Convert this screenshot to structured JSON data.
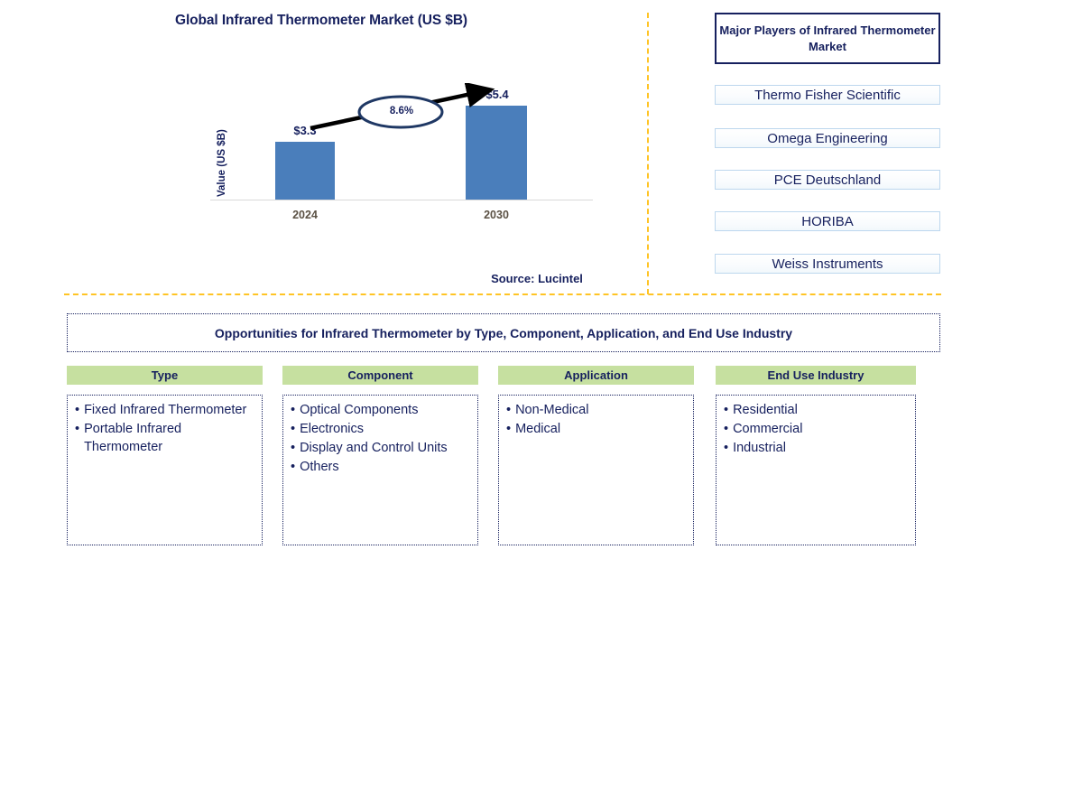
{
  "chart": {
    "title": "Global Infrared Thermometer Market (US $B)",
    "y_axis_label": "Value (US $B)",
    "source": "Source: Lucintel",
    "cagr_label": "8.6%"
  },
  "chart_data": {
    "type": "bar",
    "title": "Global Infrared Thermometer Market (US $B)",
    "xlabel": "",
    "ylabel": "Value (US $B)",
    "categories": [
      "2024",
      "2030"
    ],
    "values": [
      3.3,
      5.4
    ],
    "value_labels": [
      "$3.3",
      "$5.4"
    ],
    "cagr": "8.6%",
    "ylim": [
      0,
      5.4
    ],
    "grid": false,
    "legend": null,
    "bar_color": "#4A7EBB",
    "annotations": [
      "8.6%"
    ],
    "source": "Source: Lucintel"
  },
  "players": {
    "header": "Major Players of Infrared Thermometer Market",
    "items": [
      "Thermo Fisher Scientific",
      "Omega Engineering",
      "PCE Deutschland",
      "HORIBA",
      "Weiss Instruments"
    ]
  },
  "opportunities": {
    "banner": "Opportunities for Infrared Thermometer by Type, Component, Application, and End Use Industry",
    "columns": [
      {
        "header": "Type",
        "items": [
          "Fixed Infrared Thermometer",
          "Portable Infrared Thermometer"
        ]
      },
      {
        "header": "Component",
        "items": [
          "Optical Components",
          "Electronics",
          "Display and Control Units",
          "Others"
        ]
      },
      {
        "header": "Application",
        "items": [
          "Non-Medical",
          "Medical"
        ]
      },
      {
        "header": "End Use Industry",
        "items": [
          "Residential",
          "Commercial",
          "Industrial"
        ]
      }
    ]
  },
  "colors": {
    "navy": "#16205E",
    "bar_blue": "#4A7EBB",
    "header_green": "#C6E0A0",
    "divider_gold": "#FFC425",
    "player_border": "#BDD7EE"
  },
  "bullet_glyph": "•"
}
